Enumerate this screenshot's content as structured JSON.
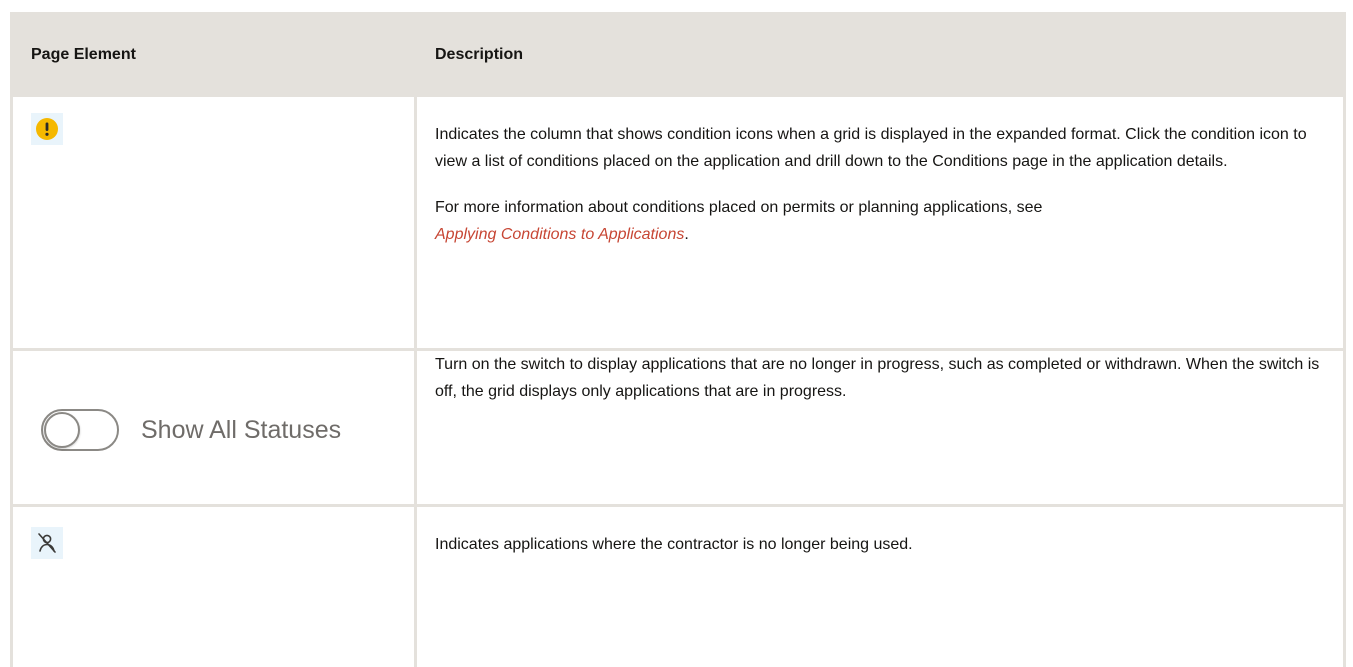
{
  "table": {
    "headers": {
      "element": "Page Element",
      "description": "Description"
    },
    "rows": [
      {
        "element_icon": "exclamation-circle-icon",
        "paragraphs": [
          "Indicates the column that shows condition icons when a grid is displayed in the expanded format. Click the condition icon to view a list of conditions placed on the application and drill down to the Conditions page in the application details.",
          "For more information about conditions placed on permits or planning applications, see"
        ],
        "link_text": "Applying Conditions to Applications",
        "link_suffix": "."
      },
      {
        "element_label": "Show All Statuses",
        "switch_state": "off",
        "paragraphs": [
          "Turn on the switch to display applications that are no longer in progress, such as completed or withdrawn. When the switch is off, the grid displays only applications that are in progress."
        ]
      },
      {
        "element_icon": "contractor-removed-icon",
        "paragraphs": [
          "Indicates applications where the contractor is no longer being used."
        ]
      }
    ]
  },
  "colors": {
    "header_bg": "#e4e1dc",
    "link": "#c74634",
    "warning": "#f5b800",
    "icon_bg": "#e9f4fb"
  }
}
